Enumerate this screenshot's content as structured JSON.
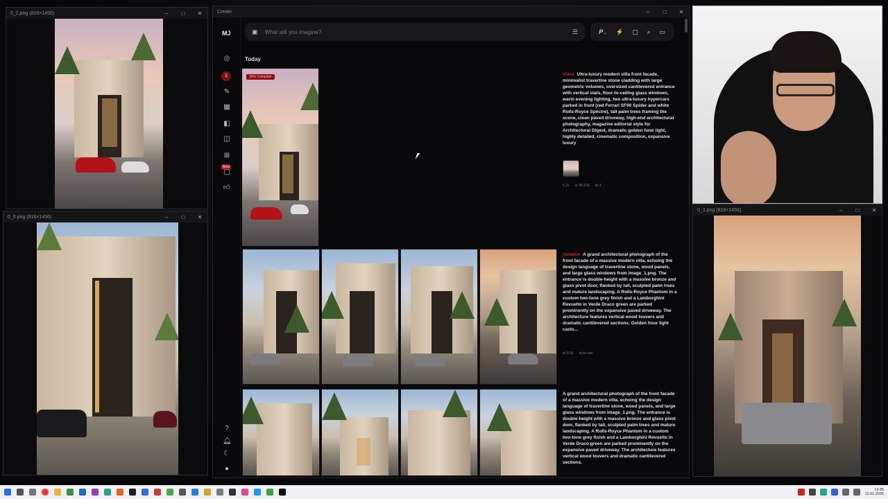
{
  "left_windows": {
    "top": {
      "title": "0_2.png (816×1456)"
    },
    "bottom": {
      "title": "0_0.png (816×1456)"
    }
  },
  "right_window": {
    "title": "0_3.png (816×1456)"
  },
  "mj": {
    "window_title": "Create",
    "logo": "MJ",
    "notification_count": "1",
    "beta_label": "Beta",
    "search": {
      "placeholder": "What will you imagine?"
    },
    "toolbar": {
      "p_label": "P",
      "chevron": "⌄",
      "bolt": "⚡",
      "chat": "▢",
      "search": "⌕",
      "folder": "▭"
    },
    "section_title": "Today",
    "job1": {
      "progress": "35% Complete",
      "tag": "Video",
      "prompt": "Ultra-luxury modern villa front facade, minimalist travertine stone cladding with large geometric volumes, oversized cantilevered entrance with vertical slats, floor-to-ceiling glass windows, warm evening lighting, two ultra-luxury hypercars parked in front (red Ferrari SF90 Spider and white Rolls-Royce Spectre), tall palm trees framing the scene, clean paved driveway, high-end architectural photography, magazine editorial style for Architectural Digest, dramatic golden hour light, highly detailed, cinematic composition, expansive luxury",
      "meta": [
        "5.2s",
        "ar 45:103",
        "bs 1"
      ]
    },
    "job2": {
      "tag": "Variation",
      "prompt": "A grand architectural photograph of the front facade of a massive modern villa, echoing the design language of travertine stone, wood panels, and large glass windows from image_1.png. The entrance is double-height with a massive bronze and glass pivot door, flanked by tall, sculpted palm trees and mature landscaping. A Rolls-Royce Phantom in a custom two-tone grey finish and a Lamborghini Revuelto in Verde Draco green are parked prominently on the expansive paved driveway. The architecture features vertical wood louvers and dramatic cantilevered sections. Golden hour light casts...",
      "meta": [
        "ar 9:16",
        "style raw"
      ]
    },
    "job3": {
      "prompt": "A grand architectural photograph of the front facade of a massive modern villa, echoing the design language of travertine stone, wood panels, and large glass windows from image_1.png. The entrance is double-height with a massive bronze and glass pivot door, flanked by tall, sculpted palm trees and mature landscaping. A Rolls-Royce Phantom in a custom two-tone grey finish and a Lamborghini Revuelto in Verde Draco green are parked prominently on the expansive paved driveway. The architecture features vertical wood louvers and dramatic cantilevered sections."
    }
  },
  "taskbar": {
    "time": "13:35",
    "date": "12.01.2026"
  }
}
